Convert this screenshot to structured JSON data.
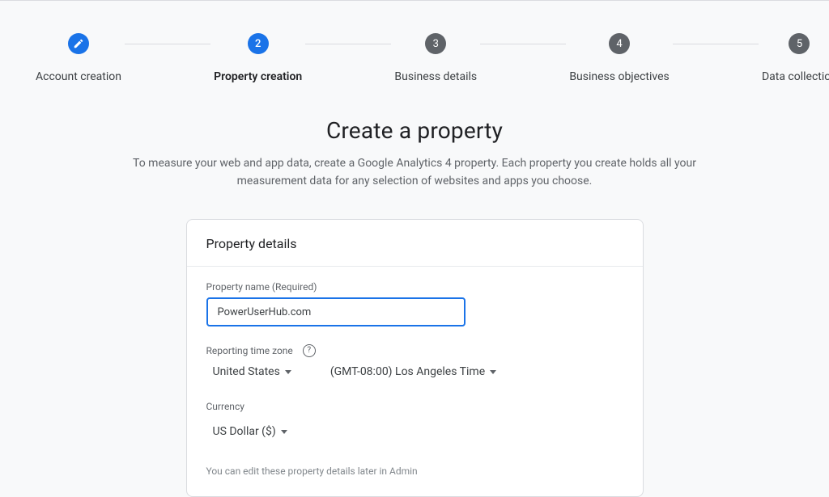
{
  "stepper": {
    "steps": [
      {
        "label": "Account creation",
        "state": "done",
        "badge": "edit"
      },
      {
        "label": "Property creation",
        "state": "active",
        "badge": "2"
      },
      {
        "label": "Business details",
        "state": "pending",
        "badge": "3"
      },
      {
        "label": "Business objectives",
        "state": "pending",
        "badge": "4"
      },
      {
        "label": "Data collection",
        "state": "pending",
        "badge": "5"
      }
    ]
  },
  "header": {
    "title": "Create a property",
    "subtitle": "To measure your web and app data, create a Google Analytics 4 property. Each property you create holds all your measurement data for any selection of websites and apps you choose."
  },
  "card": {
    "title": "Property details",
    "property_name": {
      "label": "Property name (Required)",
      "value": "PowerUserHub.com"
    },
    "timezone": {
      "label": "Reporting time zone",
      "country": "United States",
      "zone": "(GMT-08:00) Los Angeles Time"
    },
    "currency": {
      "label": "Currency",
      "value": "US Dollar ($)"
    },
    "hint": "You can edit these property details later in Admin"
  }
}
